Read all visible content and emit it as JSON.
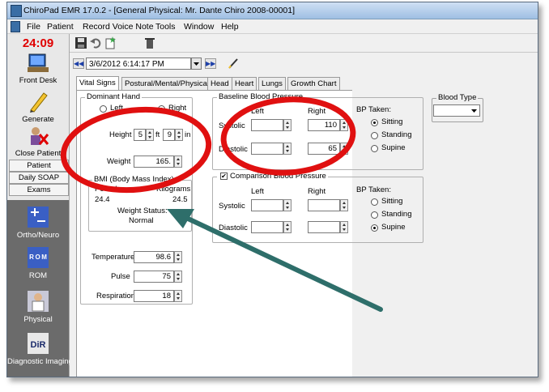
{
  "window": {
    "title": "ChiroPad EMR  17.0.2 - [General Physical:  Mr. Dante Chiro 2008-00001]"
  },
  "menu": [
    "File",
    "Patient",
    "Record Voice Note",
    "Tools",
    "Window",
    "Help"
  ],
  "sidebar": {
    "clock": "24:09",
    "buttons": [
      "Front Desk",
      "Generate",
      "Close Patient"
    ],
    "tabs": [
      "Patient",
      "Daily SOAP",
      "Exams"
    ],
    "modules": [
      "Ortho/Neuro",
      "ROM",
      "Physical",
      "Diagnostic Imaging"
    ],
    "module_icon_text": {
      "rom": "R O M",
      "dir": "DiR"
    }
  },
  "toolbar": {
    "date": "3/6/2012 6:14:17 PM"
  },
  "tabs": [
    "Vital Signs",
    "Postural/Mental/Physical",
    "Head",
    "Heart",
    "Lungs",
    "Growth Chart"
  ],
  "vitals": {
    "dominant_hand": {
      "label": "Dominant Hand",
      "left": "Left",
      "right": "Right",
      "selected": "Right"
    },
    "height": {
      "label": "Height",
      "ft_value": "5",
      "ft_unit": "ft",
      "in_value": "9",
      "in_unit": "in"
    },
    "weight": {
      "label": "Weight",
      "value": "165."
    },
    "bmi": {
      "label": "BMI (Body Mass Index)",
      "pounds_label": "Pounds",
      "kilograms_label": "Kilograms",
      "pounds_value": "24.4",
      "kilograms_value": "24.5",
      "status_label": "Weight Status:",
      "status_value": "Normal"
    },
    "temperature": {
      "label": "Temperature",
      "value": "98.6"
    },
    "pulse": {
      "label": "Pulse",
      "value": "75"
    },
    "respiration": {
      "label": "Respiration",
      "value": "18"
    }
  },
  "baseline_bp": {
    "label": "Baseline Blood Pressure",
    "left_label": "Left",
    "right_label": "Right",
    "systolic_label": "Systolic",
    "diastolic_label": "Diastolic",
    "left_systolic": "",
    "right_systolic": "110",
    "left_diastolic": "",
    "right_diastolic": "65",
    "bp_taken_label": "BP Taken:",
    "options": [
      "Sitting",
      "Standing",
      "Supine"
    ],
    "selected": "Sitting"
  },
  "comparison_bp": {
    "label": "Comparison Blood Pressure",
    "checked": true,
    "left_label": "Left",
    "right_label": "Right",
    "systolic_label": "Systolic",
    "diastolic_label": "Diastolic",
    "bp_taken_label": "BP Taken:",
    "options": [
      "Sitting",
      "Standing",
      "Supine"
    ],
    "selected": "Supine"
  },
  "blood_type": {
    "label": "Blood Type",
    "value": ""
  },
  "colors": {
    "annotation_red": "#e01010",
    "annotation_arrow": "#2e6e6a",
    "clock_red": "#e00000"
  }
}
